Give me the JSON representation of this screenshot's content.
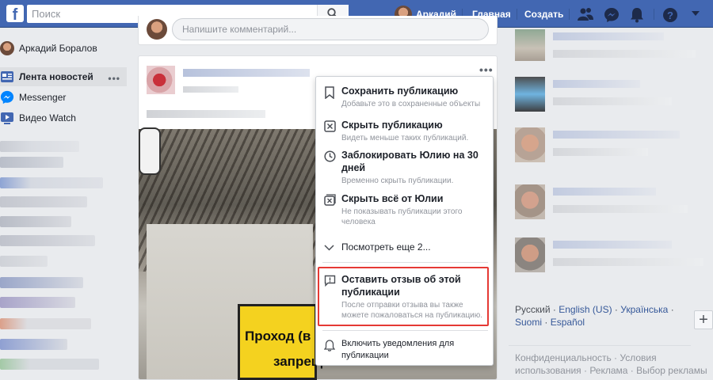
{
  "topbar": {
    "logo": "f",
    "search_placeholder": "Поиск",
    "user_name": "Аркадий",
    "home": "Главная",
    "create": "Создать",
    "icons": [
      "friends-icon",
      "messenger-icon",
      "notifications-icon",
      "help-icon",
      "dropdown-icon"
    ]
  },
  "sidebar": {
    "profile_name": "Аркадий Боралов",
    "items": [
      {
        "label": "Лента новостей",
        "icon": "news-feed-icon"
      },
      {
        "label": "Messenger",
        "icon": "messenger-icon"
      },
      {
        "label": "Видео Watch",
        "icon": "watch-icon"
      }
    ],
    "more": "•••"
  },
  "composer": {
    "comment_placeholder": "Напишите комментарий..."
  },
  "post": {
    "more": "•••",
    "sign_line1": "Проход (в",
    "sign_line2": "запрещен"
  },
  "menu": {
    "items": [
      {
        "title": "Сохранить публикацию",
        "subtitle": "Добавьте это в сохраненные объекты",
        "icon": "bookmark-icon"
      },
      {
        "title": "Скрыть публикацию",
        "subtitle": "Видеть меньше таких публикаций.",
        "icon": "hide-icon"
      },
      {
        "title": "Заблокировать Юлию на 30 дней",
        "subtitle": "Временно скрыть публикации.",
        "icon": "clock-icon"
      },
      {
        "title": "Скрыть всё от Юлии",
        "subtitle": "Не показывать публикации этого человека",
        "icon": "hide-all-icon"
      },
      {
        "title": "Посмотреть еще 2...",
        "icon": "chevron-down-icon"
      },
      {
        "title": "Оставить отзыв об этой публикации",
        "subtitle": "После отправки отзыва вы также можете пожаловаться на публикацию.",
        "icon": "feedback-icon"
      },
      {
        "title": "Включить уведомления для публикации",
        "icon": "bell-icon"
      }
    ]
  },
  "languages": {
    "current": "Русский",
    "links": [
      "English (US)",
      "Українська",
      "Suomi",
      "Español"
    ],
    "separator": "·"
  },
  "footer": {
    "line1": "Конфиденциальность · Условия",
    "line2": "использования · Реклама · Выбор рекламы"
  },
  "colors": {
    "brand": "#4267b2",
    "highlight": "#e53935"
  }
}
